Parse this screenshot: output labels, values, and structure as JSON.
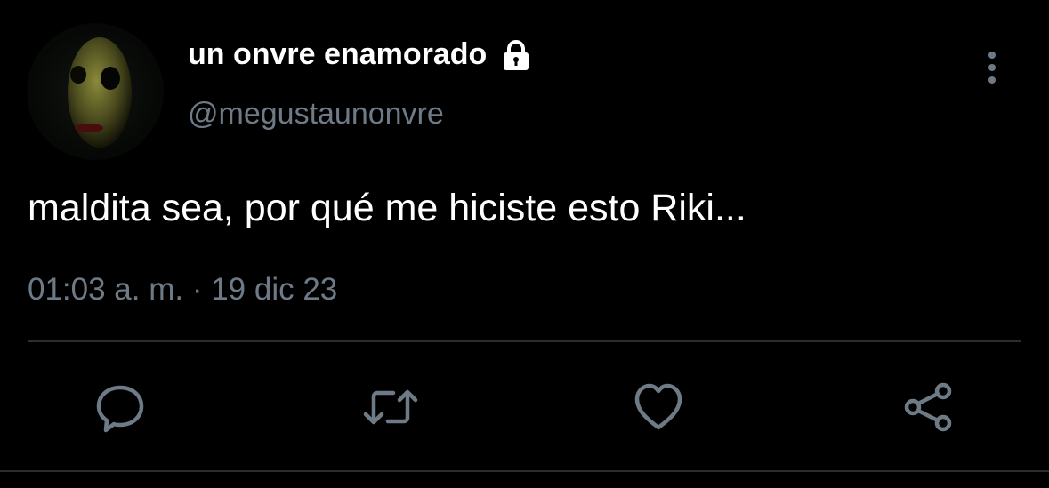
{
  "tweet": {
    "display_name": "un onvre enamorado",
    "handle": "@megustaunonvre",
    "text": "maldita sea, por qué me hiciste esto Riki...",
    "timestamp": "01:03 a. m. · 19 dic 23"
  },
  "icons": {
    "lock": "lock-icon",
    "more": "more-vertical-icon",
    "reply": "reply-icon",
    "retweet": "retweet-icon",
    "like": "heart-icon",
    "share": "share-icon"
  },
  "colors": {
    "background": "#000000",
    "primary_text": "#ffffff",
    "secondary_text": "#6e7a86",
    "divider": "#2a2e33"
  }
}
